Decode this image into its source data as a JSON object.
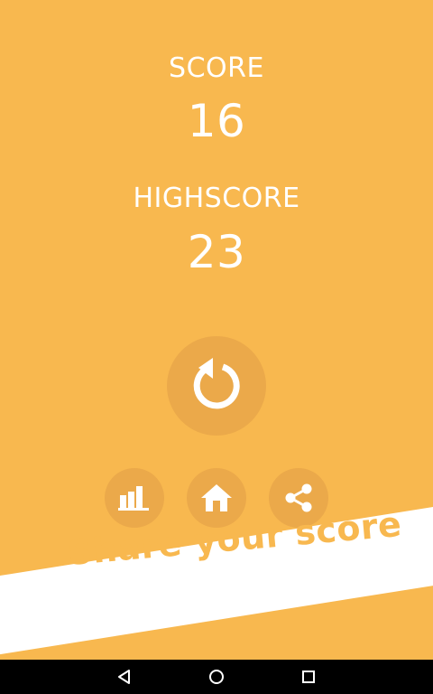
{
  "score": {
    "label": "SCORE",
    "value": "16"
  },
  "highscore": {
    "label": "HIGHSCORE",
    "value": "23"
  },
  "buttons": {
    "replay_icon": "replay-icon",
    "stats_icon": "bar-chart-icon",
    "home_icon": "home-icon",
    "share_icon": "share-icon"
  },
  "share_banner": {
    "text": "Share your score"
  },
  "navbar": {
    "back_icon": "back-triangle-icon",
    "home_icon": "home-circle-icon",
    "recents_icon": "recents-square-icon"
  },
  "colors": {
    "background": "#f8b84f",
    "button": "#eba94a",
    "text": "#ffffff",
    "banner": "#ffffff"
  }
}
